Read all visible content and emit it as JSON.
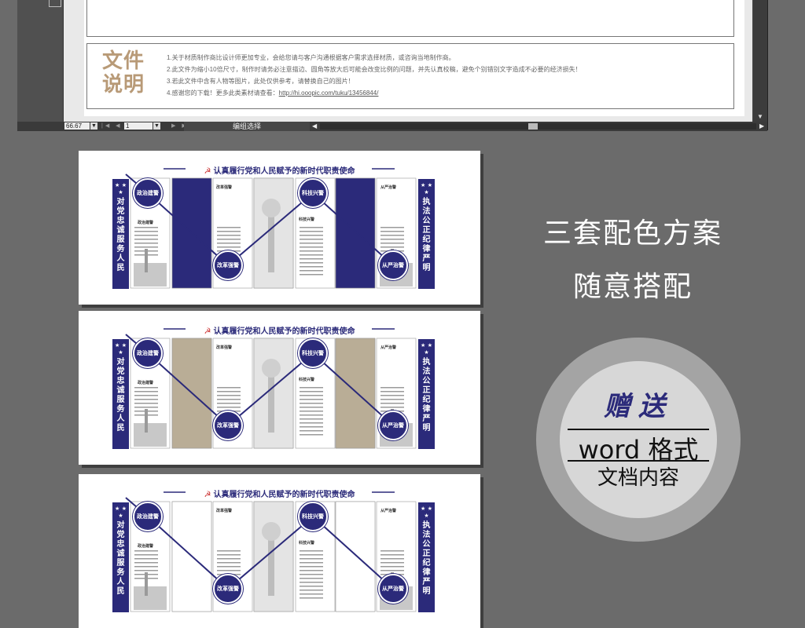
{
  "editor": {
    "note_title": "文件\n说明",
    "notes": [
      "1.关于材质制作商比设计师更加专业，会给您请与客户沟通根据客户需求选择材质，或咨询当地制作商。",
      "2.此文件为缩小10倍尺寸，制作时请务必注意描边、圆角等放大后可能会改变比例的问题，并先认真校稿，避免个别错别文字造成不必要的经济损失！",
      "3.若此文件中含有人物等图片，此处仅供参考，请替换自己的图片！"
    ],
    "note4_prefix": "4.感谢您的下载！更多此类素材请查看：",
    "note4_link": "http://hi.ooopic.com/tuku/13456844/",
    "status": {
      "zoom": "66.67",
      "page": "1",
      "mode": "编组选择"
    }
  },
  "boards": {
    "title": "认真履行党和人民赋予的新时代职责使命",
    "left_banner": "对党忠诚 服务人民",
    "right_banner": "执法公正 纪律严明",
    "stars": "★ ★ ★",
    "circles": [
      "政治建警",
      "改革强警",
      "科技兴警",
      "从严治警"
    ],
    "subheads": [
      "政治建警",
      "改革强警",
      "科技兴警",
      "从严治警"
    ],
    "schemes": [
      {
        "name": "blue",
        "panel_color": "#2b2a7a"
      },
      {
        "name": "khaki",
        "panel_color": "#b9ad96"
      },
      {
        "name": "white",
        "panel_color": "#ffffff"
      }
    ]
  },
  "caption": {
    "line1": "三套配色方案",
    "line2": "随意搭配"
  },
  "badge": {
    "gift": "赠送",
    "word": "word 格式",
    "doc": "文档内容"
  },
  "colors": {
    "navy": "#2b2a7a",
    "khaki": "#b9ad96",
    "note_title": "#b89a77",
    "background": "#6b6b6b"
  }
}
